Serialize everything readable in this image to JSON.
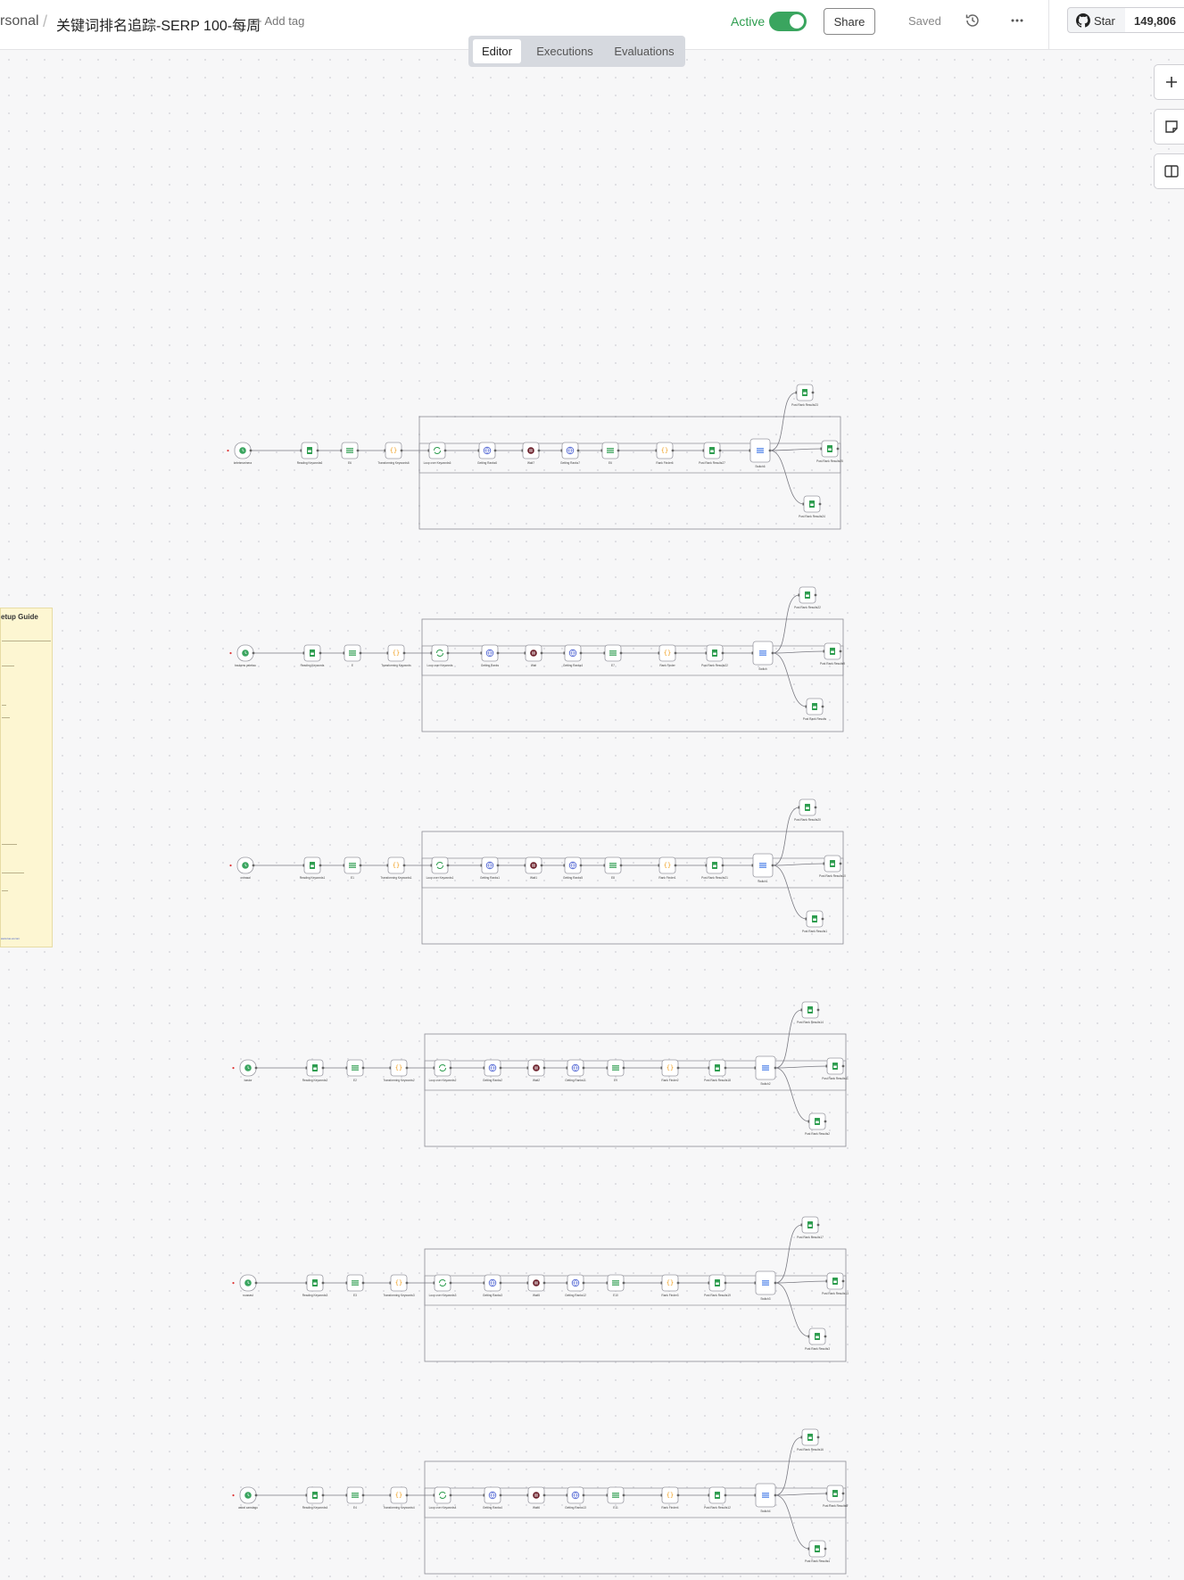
{
  "header": {
    "breadcrumb_project": "rsonal",
    "workflow_title": "关键词排名追踪-SERP 100-每周",
    "add_tag": "+ Add tag",
    "active_label": "Active",
    "active_on": true,
    "share_label": "Share",
    "saved_label": "Saved",
    "github_star_label": "Star",
    "github_star_count": "149,806"
  },
  "tabs": [
    {
      "label": "Editor",
      "selected": true
    },
    {
      "label": "Executions",
      "selected": false
    },
    {
      "label": "Evaluations",
      "selected": false
    }
  ],
  "side_tools": [
    "plus-icon",
    "sticky-note-icon",
    "panel-icon"
  ],
  "sticky_note": {
    "title": "etup Guide",
    "footer_link": "www.luo-ai.com"
  },
  "colors": {
    "accent_green": "#3aa55f",
    "sheets_green": "#2e9d4f",
    "http_blue": "#5b6fd6",
    "code_orange": "#f0a020",
    "switch_blue": "#4a7fe8",
    "wait_dark": "#6b1f2a"
  },
  "workflow_rows": [
    {
      "trigger": "kelebmarinera",
      "nodes": [
        "Reading Keywords6",
        "E6",
        "Transforming Keywords6",
        "Loop over Keywords6",
        "Getting Ranks6",
        "Wait7",
        "Getting Ranks7",
        "E6",
        "Rank Finder6",
        "Post Rank Results27",
        "Switch6"
      ],
      "outputs": [
        "Post Rank Results23",
        "Post Rank Results25",
        "Post Rank Results24"
      ]
    },
    {
      "trigger": "baukens yateksu",
      "nodes": [
        "Reading Keywords",
        "E",
        "Transforming Keywords",
        "Loop over Keywords",
        "Getting Ranks",
        "Wait",
        "Getting Ranks4",
        "E7",
        "Rank Finder",
        "Post Rank Results22",
        "Switch"
      ],
      "outputs": [
        "Post Rank Results22",
        "Post Rank Results9",
        "Post Rank Results"
      ]
    },
    {
      "trigger": "ontrasal",
      "nodes": [
        "Reading Keywords1",
        "E1",
        "Transforming Keywords1",
        "Loop over Keywords1",
        "Getting Ranks1",
        "Wait1",
        "Getting Ranks5",
        "E8",
        "Rank Finder1",
        "Post Rank Results21",
        "Switch1"
      ],
      "outputs": [
        "Post Rank Results20",
        "Post Rank Results10",
        "Post Rank Results1"
      ]
    },
    {
      "trigger": "bastor",
      "nodes": [
        "Reading Keywords2",
        "E2",
        "Transforming Keywords2",
        "Loop over Keywords2",
        "Getting Ranks2",
        "Wait2",
        "Getting Ranks11",
        "E9",
        "Rank Finder2",
        "Post Rank Results18",
        "Switch2"
      ],
      "outputs": [
        "Post Rank Results14",
        "Post Rank Results11",
        "Post Rank Results2"
      ]
    },
    {
      "trigger": "rousseul",
      "nodes": [
        "Reading Keywords3",
        "E3",
        "Transforming Keywords3",
        "Loop over Keywords3",
        "Getting Ranks3",
        "Wait5",
        "Getting Ranks12",
        "E10",
        "Rank Finder3",
        "Post Rank Results19",
        "Switch3"
      ],
      "outputs": [
        "Post Rank Results17",
        "Post Rank Results13",
        "Post Rank Results3"
      ]
    },
    {
      "trigger": "astral camdagu",
      "nodes": [
        "Reading Keywords4",
        "E4",
        "Transforming Keywords4",
        "Loop over Keywords4",
        "Getting Ranks4",
        "Wait6",
        "Getting Ranks13",
        "E11",
        "Rank Finder4",
        "Post Rank Results12",
        "Switch4"
      ],
      "outputs": [
        "Post Rank Results16",
        "Post Rank Results8",
        "Post Rank Results4"
      ]
    }
  ]
}
